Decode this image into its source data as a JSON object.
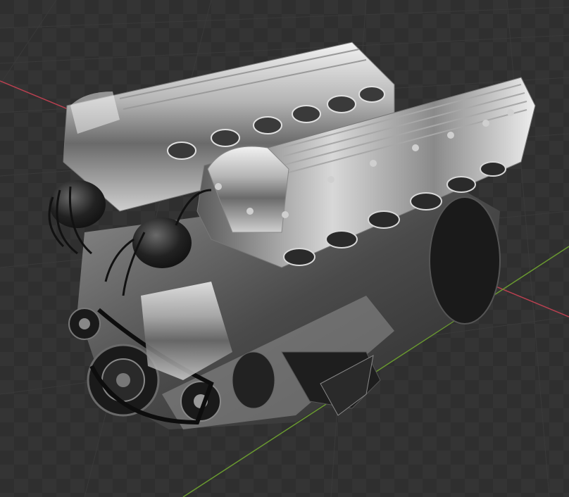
{
  "viewport": {
    "background_color": "#2f2f2f",
    "checker_color": "#343434",
    "grid_line_color": "#3a3a3a",
    "x_axis_color": "#b84050",
    "y_axis_color": "#6a9a30"
  },
  "model": {
    "subject": "engine-3d-model",
    "metal_light": "#e6e6e6",
    "metal_mid": "#9a9a9a",
    "metal_dark": "#3e3e3e",
    "black_part": "#1c1c1c"
  }
}
